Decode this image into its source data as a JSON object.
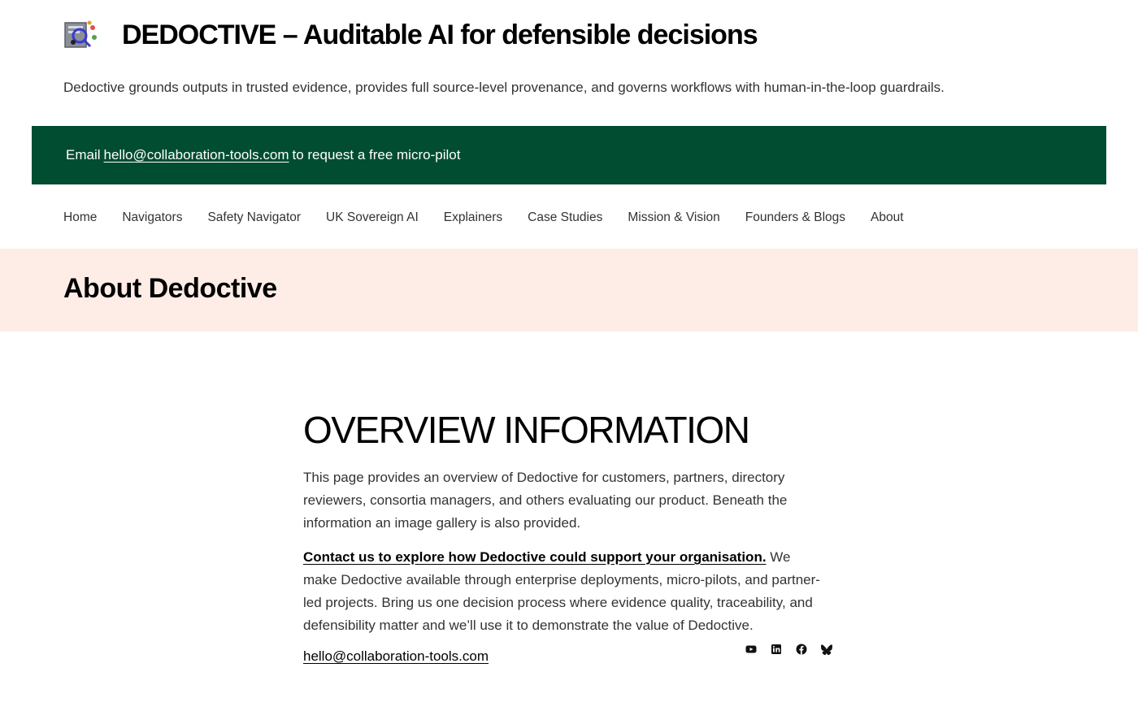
{
  "header": {
    "logo_icon": "dedoctive-logo-icon",
    "title": "DEDOCTIVE – Auditable AI for defensible decisions",
    "tagline": "Dedoctive grounds outputs in trusted evidence, provides full source-level provenance, and governs workflows with human-in-the-loop guardrails."
  },
  "banner": {
    "prefix": "Email",
    "email": "hello@collaboration-tools.com",
    "suffix": "to request a free micro-pilot",
    "background": "#004d32"
  },
  "nav": {
    "items": [
      {
        "label": "Home"
      },
      {
        "label": "Navigators"
      },
      {
        "label": "Safety Navigator"
      },
      {
        "label": "UK Sovereign AI"
      },
      {
        "label": "Explainers"
      },
      {
        "label": "Case Studies"
      },
      {
        "label": "Mission & Vision"
      },
      {
        "label": "Founders & Blogs"
      },
      {
        "label": "About"
      }
    ]
  },
  "hero": {
    "title": "About Dedoctive",
    "background": "#fdede6"
  },
  "content": {
    "heading": "OVERVIEW INFORMATION",
    "paragraph1": "This page provides an overview of Dedoctive for customers, partners, directory reviewers, consortia managers, and others evaluating our product. Beneath the information an image gallery is also provided.",
    "contact_link": "Contact us to explore how Dedoctive could support your organisation.",
    "paragraph2_rest": " We make Dedoctive available through enterprise deployments, micro-pilots, and partner-led projects. Bring us one decision process where evidence quality, traceability, and defensibility matter and we’ll use it to demonstrate the value of Dedoctive.",
    "email": "hello@collaboration-tools.com"
  },
  "social": {
    "icons": [
      "youtube-icon",
      "linkedin-icon",
      "facebook-icon",
      "bluesky-icon"
    ]
  }
}
